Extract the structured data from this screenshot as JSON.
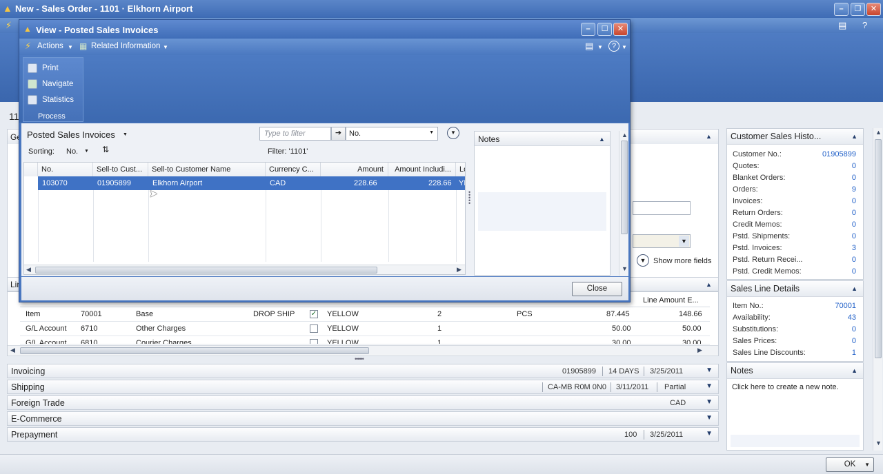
{
  "main_window": {
    "title": "New - Sales Order - 1101 · Elkhorn Airport",
    "partial_number": "11",
    "partial_tab_ge": "Ge",
    "partial_lines": "Lin",
    "show_more_fields": "Show more fields"
  },
  "lines": {
    "header_last": "Line Amount E...",
    "rows": [
      {
        "type": "Item",
        "no": "70001",
        "desc": "Base",
        "purch": "DROP SHIP",
        "checked": true,
        "loc": "YELLOW",
        "qty": "2",
        "uom": "PCS",
        "price": "87.445",
        "amount": "148.66"
      },
      {
        "type": "G/L Account",
        "no": "6710",
        "desc": "Other Charges",
        "purch": "",
        "checked": false,
        "loc": "YELLOW",
        "qty": "1",
        "uom": "",
        "price": "50.00",
        "amount": "50.00"
      },
      {
        "type": "G/L Account",
        "no": "6810",
        "desc": "Courier Charges",
        "purch": "",
        "checked": false,
        "loc": "YELLOW",
        "qty": "1",
        "uom": "",
        "price": "30.00",
        "amount": "30.00"
      }
    ]
  },
  "fasttabs": {
    "invoicing": {
      "label": "Invoicing",
      "v1": "01905899",
      "v2": "14 DAYS",
      "v3": "3/25/2011"
    },
    "shipping": {
      "label": "Shipping",
      "v1": "CA-MB R0M 0N0",
      "v2": "3/11/2011",
      "v3": "Partial"
    },
    "foreign_trade": {
      "label": "Foreign Trade",
      "v1": "CAD"
    },
    "ecommerce": {
      "label": "E-Commerce"
    },
    "prepayment": {
      "label": "Prepayment",
      "v1": "100",
      "v2": "3/25/2011"
    }
  },
  "factbox": {
    "customer_history": {
      "title": "Customer Sales Histo...",
      "rows": [
        {
          "k": "Customer No.:",
          "v": "01905899"
        },
        {
          "k": "Quotes:",
          "v": "0"
        },
        {
          "k": "Blanket Orders:",
          "v": "0"
        },
        {
          "k": "Orders:",
          "v": "9"
        },
        {
          "k": "Invoices:",
          "v": "0"
        },
        {
          "k": "Return Orders:",
          "v": "0"
        },
        {
          "k": "Credit Memos:",
          "v": "0"
        },
        {
          "k": "Pstd. Shipments:",
          "v": "0"
        },
        {
          "k": "Pstd. Invoices:",
          "v": "3"
        },
        {
          "k": "Pstd. Return Recei...",
          "v": "0"
        },
        {
          "k": "Pstd. Credit Memos:",
          "v": "0"
        }
      ]
    },
    "sales_line_details": {
      "title": "Sales Line Details",
      "rows": [
        {
          "k": "Item No.:",
          "v": "70001"
        },
        {
          "k": "Availability:",
          "v": "43"
        },
        {
          "k": "Substitutions:",
          "v": "0"
        },
        {
          "k": "Sales Prices:",
          "v": "0"
        },
        {
          "k": "Sales Line Discounts:",
          "v": "1"
        }
      ]
    },
    "notes": {
      "title": "Notes",
      "link": "Click here to create a new note."
    }
  },
  "ok_button": "OK",
  "popup": {
    "title": "View - Posted Sales Invoices",
    "toolbar": {
      "actions": "Actions",
      "related": "Related Information"
    },
    "ribbon": {
      "print": "Print",
      "navigate": "Navigate",
      "statistics": "Statistics",
      "group": "Process"
    },
    "list_title": "Posted Sales Invoices",
    "filter_placeholder": "Type to filter",
    "filter_field": "No.",
    "sorting_label": "Sorting:",
    "sorting_value": "No.",
    "filter_text": "Filter: '1101'",
    "columns": [
      "No.",
      "Sell-to Cust...",
      "Sell-to Customer Name",
      "Currency C...",
      "Amount",
      "Amount Includi...",
      "Lo"
    ],
    "row": {
      "no": "103070",
      "cust": "01905899",
      "name": "Elkhorn Airport",
      "currency": "CAD",
      "amount": "228.66",
      "amount_incl": "228.66",
      "loc": "YE"
    },
    "notes_title": "Notes",
    "close_button": "Close"
  }
}
